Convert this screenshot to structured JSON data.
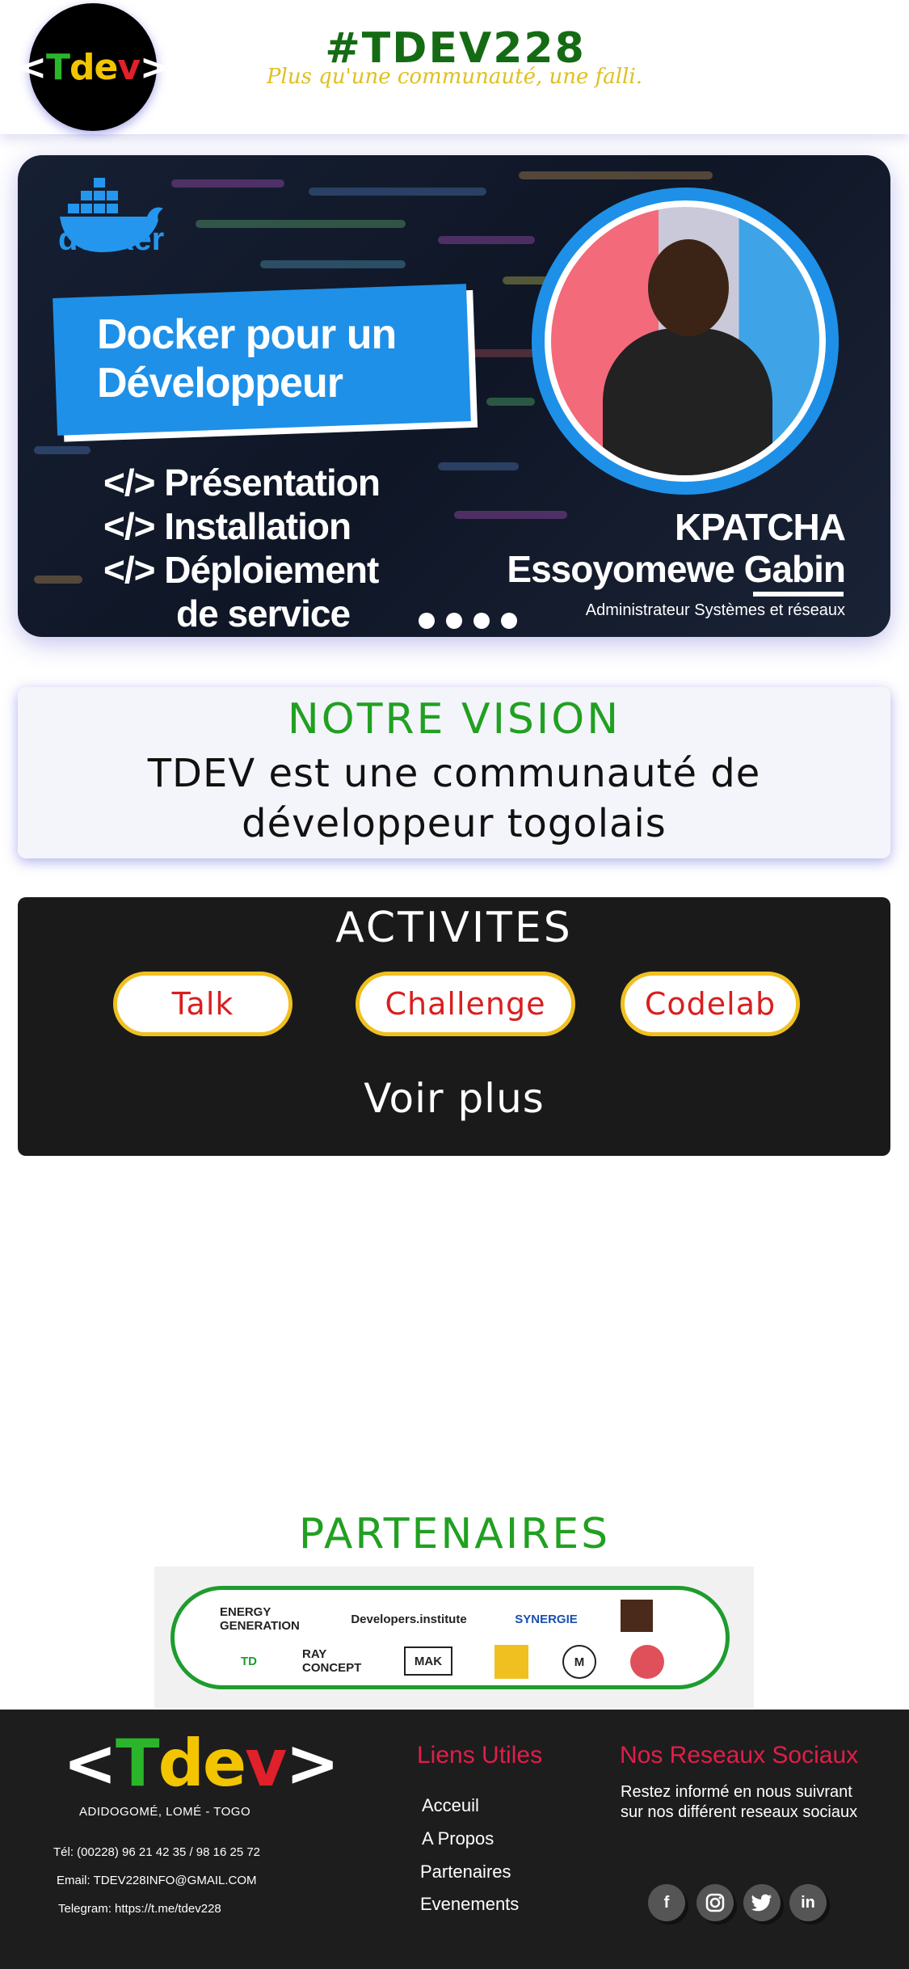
{
  "header": {
    "logo": {
      "open": "<",
      "t": "T",
      "de": "de",
      "v": "v",
      "close": ">"
    },
    "title": "#TDEV228",
    "tagline": "Plus qu'une communauté, une falli."
  },
  "hero": {
    "brand_word": "docker",
    "title_line1": "Docker pour un",
    "title_line2": "Développeur",
    "items": [
      "</> Présentation",
      "</> Installation",
      "</> Déploiement",
      "de service"
    ],
    "speaker_first": "KPATCHA",
    "speaker_last": "Essoyomewe Gabin",
    "speaker_role": "Administrateur Systèmes et réseaux",
    "slide_count": 4
  },
  "vision": {
    "title": "NOTRE VISION",
    "text": "TDEV est une communauté de développeur togolais"
  },
  "activities": {
    "title": "ACTIVITES",
    "buttons": [
      "Talk",
      "Challenge",
      "Codelab"
    ],
    "more": "Voir plus"
  },
  "partners": {
    "title": "PARTENAIRES",
    "logos": [
      "ENERGY GENERATION",
      "Developers.institute",
      "SYNERGIE",
      "TD",
      "RAY CONCEPT",
      "MAK",
      "M"
    ]
  },
  "footer": {
    "logo": {
      "open": "<",
      "t": "T",
      "de": "de",
      "v": "v",
      "close": ">"
    },
    "address": "ADIDOGOMÉ, LOMÉ - TOGO",
    "tel": "Tél: (00228) 96 21 42 35 / 98 16 25 72",
    "email": "Email:  TDEV228INFO@GMAIL.COM",
    "telegram": "Telegram: https://t.me/tdev228",
    "links_title": "Liens Utiles",
    "links": [
      "Acceuil",
      "A Propos",
      "Partenaires",
      "Evenements"
    ],
    "social_title": "Nos Reseaux Sociaux",
    "social_text": "Restez informé en nous suivrant sur nos différent reseaux sociaux",
    "social_icons": [
      "facebook-icon",
      "instagram-icon",
      "twitter-icon",
      "linkedin-icon"
    ]
  },
  "colors": {
    "green": "#21a021",
    "dark_green": "#146b14",
    "yellow": "#f0c020",
    "red": "#d81f1f",
    "footer_bg": "#1d1d1d",
    "accent_pink": "#e01e4a",
    "docker_blue": "#1e90e8"
  }
}
